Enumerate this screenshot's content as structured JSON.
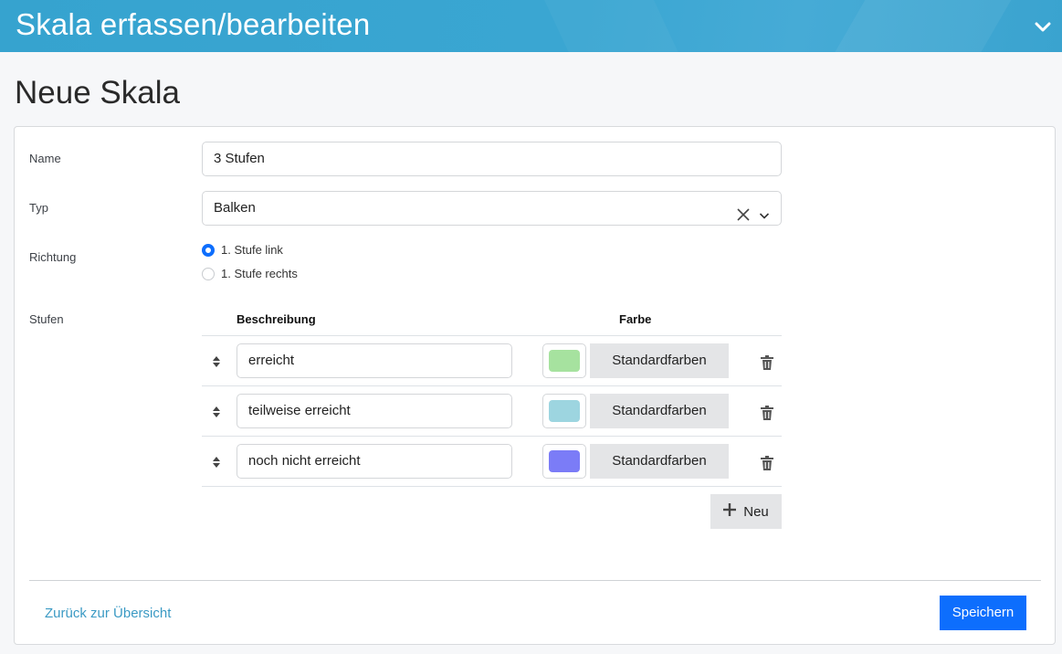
{
  "header": {
    "title": "Skala erfassen/bearbeiten",
    "toggle_icon": "chevron-down-icon"
  },
  "page": {
    "title": "Neue Skala"
  },
  "form": {
    "name_label": "Name",
    "name_value": "3 Stufen",
    "type_label": "Typ",
    "type_value": "Balken",
    "direction_label": "Richtung",
    "direction_options": [
      {
        "label": "1. Stufe link",
        "checked": true
      },
      {
        "label": "1. Stufe rechts",
        "checked": false
      }
    ],
    "levels_label": "Stufen",
    "levels_header": {
      "description": "Beschreibung",
      "color": "Farbe"
    },
    "levels": [
      {
        "description": "erreicht",
        "color": "#a6e29f",
        "std_label": "Standardfarben"
      },
      {
        "description": "teilweise erreicht",
        "color": "#9dd5e0",
        "std_label": "Standardfarben"
      },
      {
        "description": "noch nicht erreicht",
        "color": "#7b7cf7",
        "std_label": "Standardfarben"
      }
    ],
    "add_label": "Neu"
  },
  "footer": {
    "back_label": "Zurück zur Übersicht",
    "save_label": "Speichern"
  },
  "colors": {
    "accent": "#0d6efd",
    "header": "#3aa6d2",
    "link": "#3b9ac4"
  }
}
